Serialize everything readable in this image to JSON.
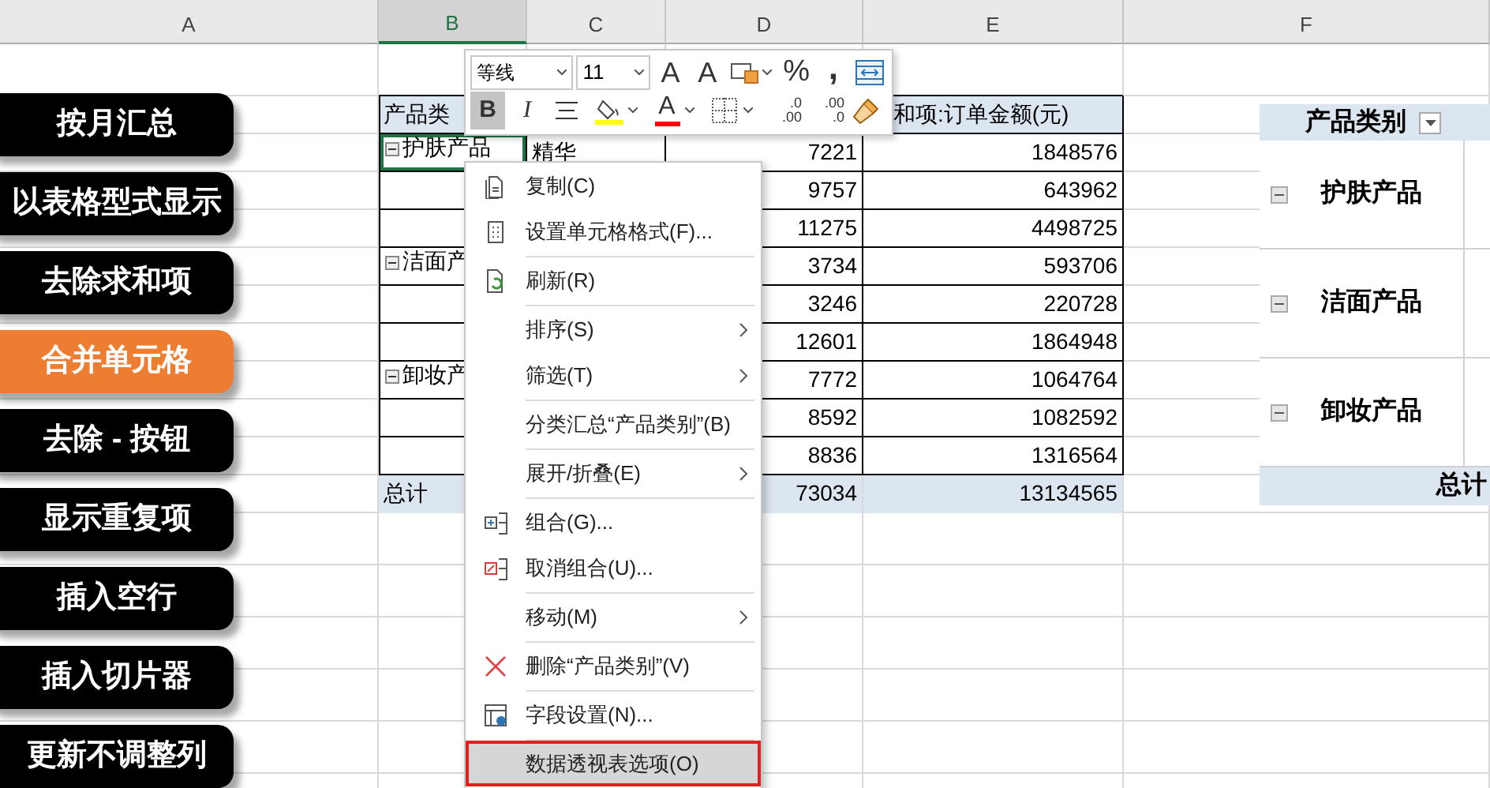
{
  "column_headers": [
    {
      "label": "A",
      "selected": false
    },
    {
      "label": "B",
      "selected": true
    },
    {
      "label": "C",
      "selected": false
    },
    {
      "label": "D",
      "selected": false
    },
    {
      "label": "E",
      "selected": false
    },
    {
      "label": "F",
      "selected": false
    }
  ],
  "side_buttons": [
    {
      "label": "按月汇总",
      "selected": false
    },
    {
      "label": "以表格型式显示",
      "selected": false
    },
    {
      "label": "去除求和项",
      "selected": false
    },
    {
      "label": "合并单元格",
      "selected": true
    },
    {
      "label": "去除 - 按钮",
      "selected": false
    },
    {
      "label": "显示重复项",
      "selected": false
    },
    {
      "label": "插入空行",
      "selected": false
    },
    {
      "label": "插入切片器",
      "selected": false
    },
    {
      "label": "更新不调整列",
      "selected": false
    }
  ],
  "pivot_table": {
    "header_label": "产品类",
    "header_values": "和项:订单金额(元)",
    "rows": [
      {
        "category": "护肤产品",
        "expanded": true,
        "item": "精华",
        "count": "7221",
        "amount": "1848576",
        "selected": true
      },
      {
        "count": "9757",
        "amount": "643962",
        "selected": false
      },
      {
        "count": "11275",
        "amount": "4498725",
        "selected": false
      },
      {
        "category": "洁面产",
        "expanded": true,
        "count": "3734",
        "amount": "593706",
        "selected": false
      },
      {
        "count": "3246",
        "amount": "220728",
        "selected": false
      },
      {
        "count": "12601",
        "amount": "1864948",
        "selected": false
      },
      {
        "category": "卸妆产",
        "expanded": true,
        "count": "7772",
        "amount": "1064764",
        "selected": false
      },
      {
        "count": "8592",
        "amount": "1082592",
        "selected": false
      },
      {
        "count": "8836",
        "amount": "1316564",
        "selected": false
      }
    ],
    "total": {
      "label": "总计",
      "count": "73034",
      "amount": "13134565"
    }
  },
  "mini_toolbar": {
    "font": "等线",
    "size": "11",
    "row_1": [
      {
        "kind": "grow",
        "glyph": "A"
      },
      {
        "kind": "shrink",
        "glyph": "A"
      },
      {
        "kind": "format"
      },
      {
        "kind": "text",
        "glyph": "%"
      },
      {
        "kind": "comma",
        "glyph": ","
      },
      {
        "kind": "wrap"
      }
    ],
    "row_2": [
      {
        "kind": "toggle",
        "glyph": "B",
        "selected": true
      },
      {
        "kind": "italic",
        "glyph": "I",
        "selected": false
      },
      {
        "kind": "align"
      },
      {
        "kind": "fill",
        "color": "#ffff00"
      },
      {
        "kind": "font_color",
        "glyph": "A",
        "color": "#ff0000"
      },
      {
        "kind": "borders"
      },
      {
        "kind": "decimal",
        "glyph": ".0",
        "glyph_2": ".00"
      },
      {
        "kind": "decimal",
        "glyph": ".00",
        "glyph_2": ".0"
      },
      {
        "kind": "painter"
      }
    ]
  },
  "context_menu": {
    "items": [
      {
        "label": "复制(C)",
        "kind": "item",
        "divider_after": false,
        "selected": false
      },
      {
        "label": "设置单元格格式(F)...",
        "kind": "item",
        "divider_after": true,
        "selected": false
      },
      {
        "label": "刷新(R)",
        "kind": "item",
        "divider_after": true,
        "selected": false
      },
      {
        "label": "排序(S)",
        "kind": "submenu",
        "divider_after": false,
        "selected": false
      },
      {
        "label": "筛选(T)",
        "kind": "submenu",
        "divider_after": true,
        "selected": false
      },
      {
        "label": "分类汇总“产品类别”(B)",
        "kind": "item",
        "divider_after": true,
        "selected": false
      },
      {
        "label": "展开/折叠(E)",
        "kind": "submenu",
        "divider_after": true,
        "selected": false
      },
      {
        "label": "组合(G)...",
        "kind": "item",
        "divider_after": false,
        "selected": false
      },
      {
        "label": "取消组合(U)...",
        "kind": "item",
        "divider_after": true,
        "selected": false
      },
      {
        "label": "移动(M)",
        "kind": "submenu",
        "divider_after": true,
        "selected": false
      },
      {
        "label": "删除“产品类别”(V)",
        "kind": "item",
        "divider_after": true,
        "selected": false
      },
      {
        "label": "字段设置(N)...",
        "kind": "item",
        "divider_after": true,
        "selected": false
      },
      {
        "label": "数据透视表选项(O)",
        "kind": "item",
        "divider_after": false,
        "selected": true
      }
    ]
  },
  "side_pivot": {
    "header": "产品类别",
    "groups": [
      {
        "label": "护肤产品",
        "expanded": true
      },
      {
        "label": "洁面产品",
        "expanded": true
      },
      {
        "label": "卸妆产品",
        "expanded": true
      }
    ],
    "total": "总计"
  }
}
